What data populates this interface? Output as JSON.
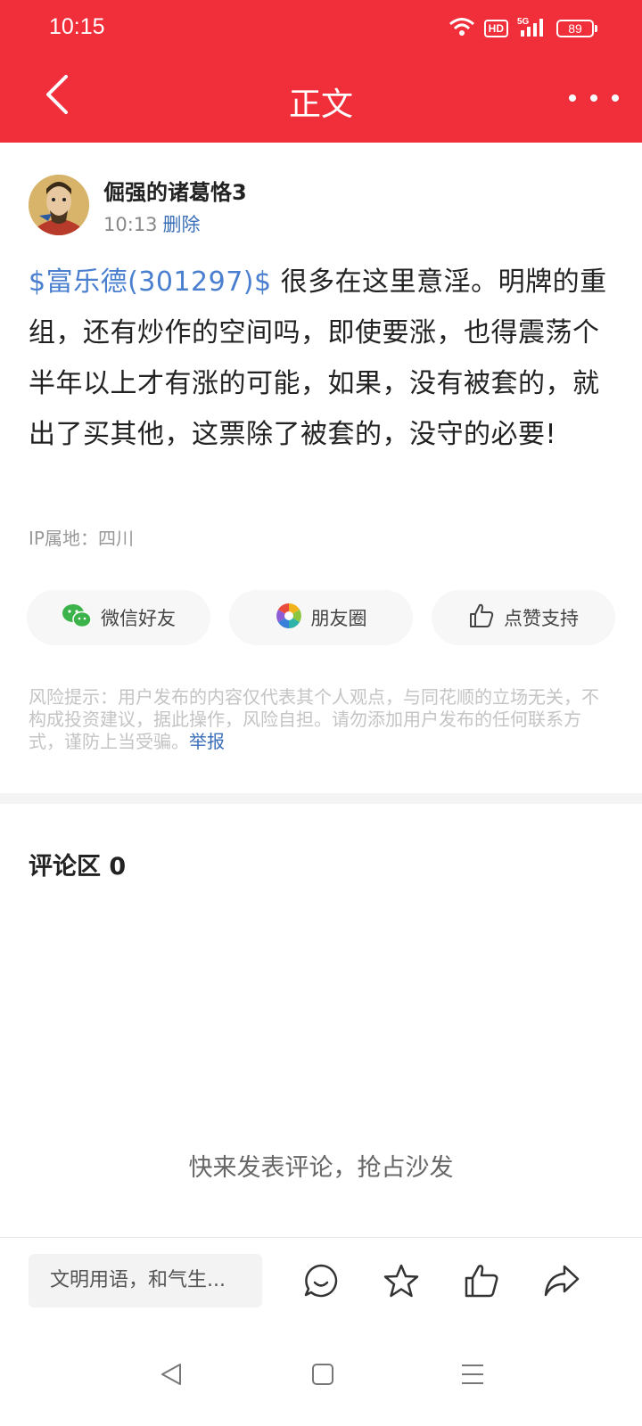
{
  "status_bar": {
    "time": "10:15",
    "hd_badge": "HD",
    "network": "5G",
    "battery": "89"
  },
  "header": {
    "title": "正文",
    "back_icon": "chevron-left-icon",
    "more_icon": "more-horizontal-icon",
    "background": "#f02f3b"
  },
  "post": {
    "author": "倔强的诸葛恪3",
    "time": "10:13",
    "delete_label": "删除",
    "stock_tag": "$富乐德(301297)$",
    "body_text": " 很多在这里意淫。明牌的重组，还有炒作的空间吗，即使要涨，也得震荡个半年以上才有涨的可能，如果，没有被套的，就出了买其他，这票除了被套的，没守的必要!",
    "ip_location": "IP属地：四川"
  },
  "share": {
    "wechat_label": "微信好友",
    "moments_label": "朋友圈",
    "like_label": "点赞支持"
  },
  "risk": {
    "text": "风险提示：用户发布的内容仅代表其个人观点，与同花顺的立场无关，不构成投资建议，据此操作，风险自担。请勿添加用户发布的任何联系方式，谨防上当受骗。",
    "report_label": "举报"
  },
  "comments": {
    "heading": "评论区 0",
    "empty_prompt": "快来发表评论，抢占沙发"
  },
  "bottom_bar": {
    "input_placeholder": "文明用语，和气生...",
    "icons": [
      "comment-icon",
      "star-icon",
      "thumbs-up-icon",
      "share-icon"
    ]
  },
  "nav_bar": {
    "icons": [
      "back-triangle-icon",
      "home-square-icon",
      "menu-icon"
    ]
  },
  "colors": {
    "accent": "#f02f3b",
    "link": "#4a7fd0",
    "wechat": "#3cb34a"
  }
}
